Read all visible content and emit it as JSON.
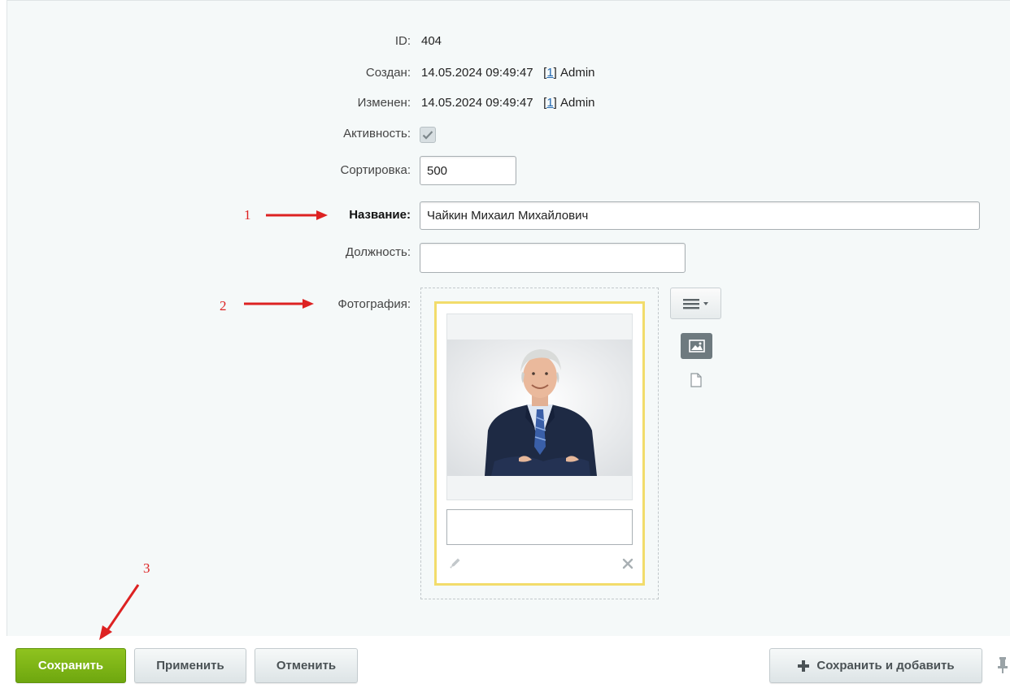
{
  "fields": {
    "id": {
      "label": "ID:",
      "value": "404"
    },
    "created": {
      "label": "Создан:",
      "datetime": "14.05.2024 09:49:47",
      "user_link": "1",
      "user_name": "Admin"
    },
    "modified": {
      "label": "Изменен:",
      "datetime": "14.05.2024 09:49:47",
      "user_link": "1",
      "user_name": "Admin"
    },
    "active": {
      "label": "Активность:",
      "checked": true
    },
    "sort": {
      "label": "Сортировка:",
      "value": "500"
    },
    "name": {
      "label": "Название:",
      "value": "Чайкин Михаил Михайлович"
    },
    "position": {
      "label": "Должность:",
      "value": ""
    },
    "photo": {
      "label": "Фотография:",
      "description": ""
    }
  },
  "annotations": {
    "one": "1",
    "two": "2",
    "three": "3"
  },
  "buttons": {
    "save": "Сохранить",
    "apply": "Применить",
    "cancel": "Отменить",
    "save_add": "Сохранить и добавить"
  },
  "colors": {
    "save_green": "#7ab317",
    "annotation_red": "#dd2222",
    "card_border": "#f2dc6b"
  }
}
